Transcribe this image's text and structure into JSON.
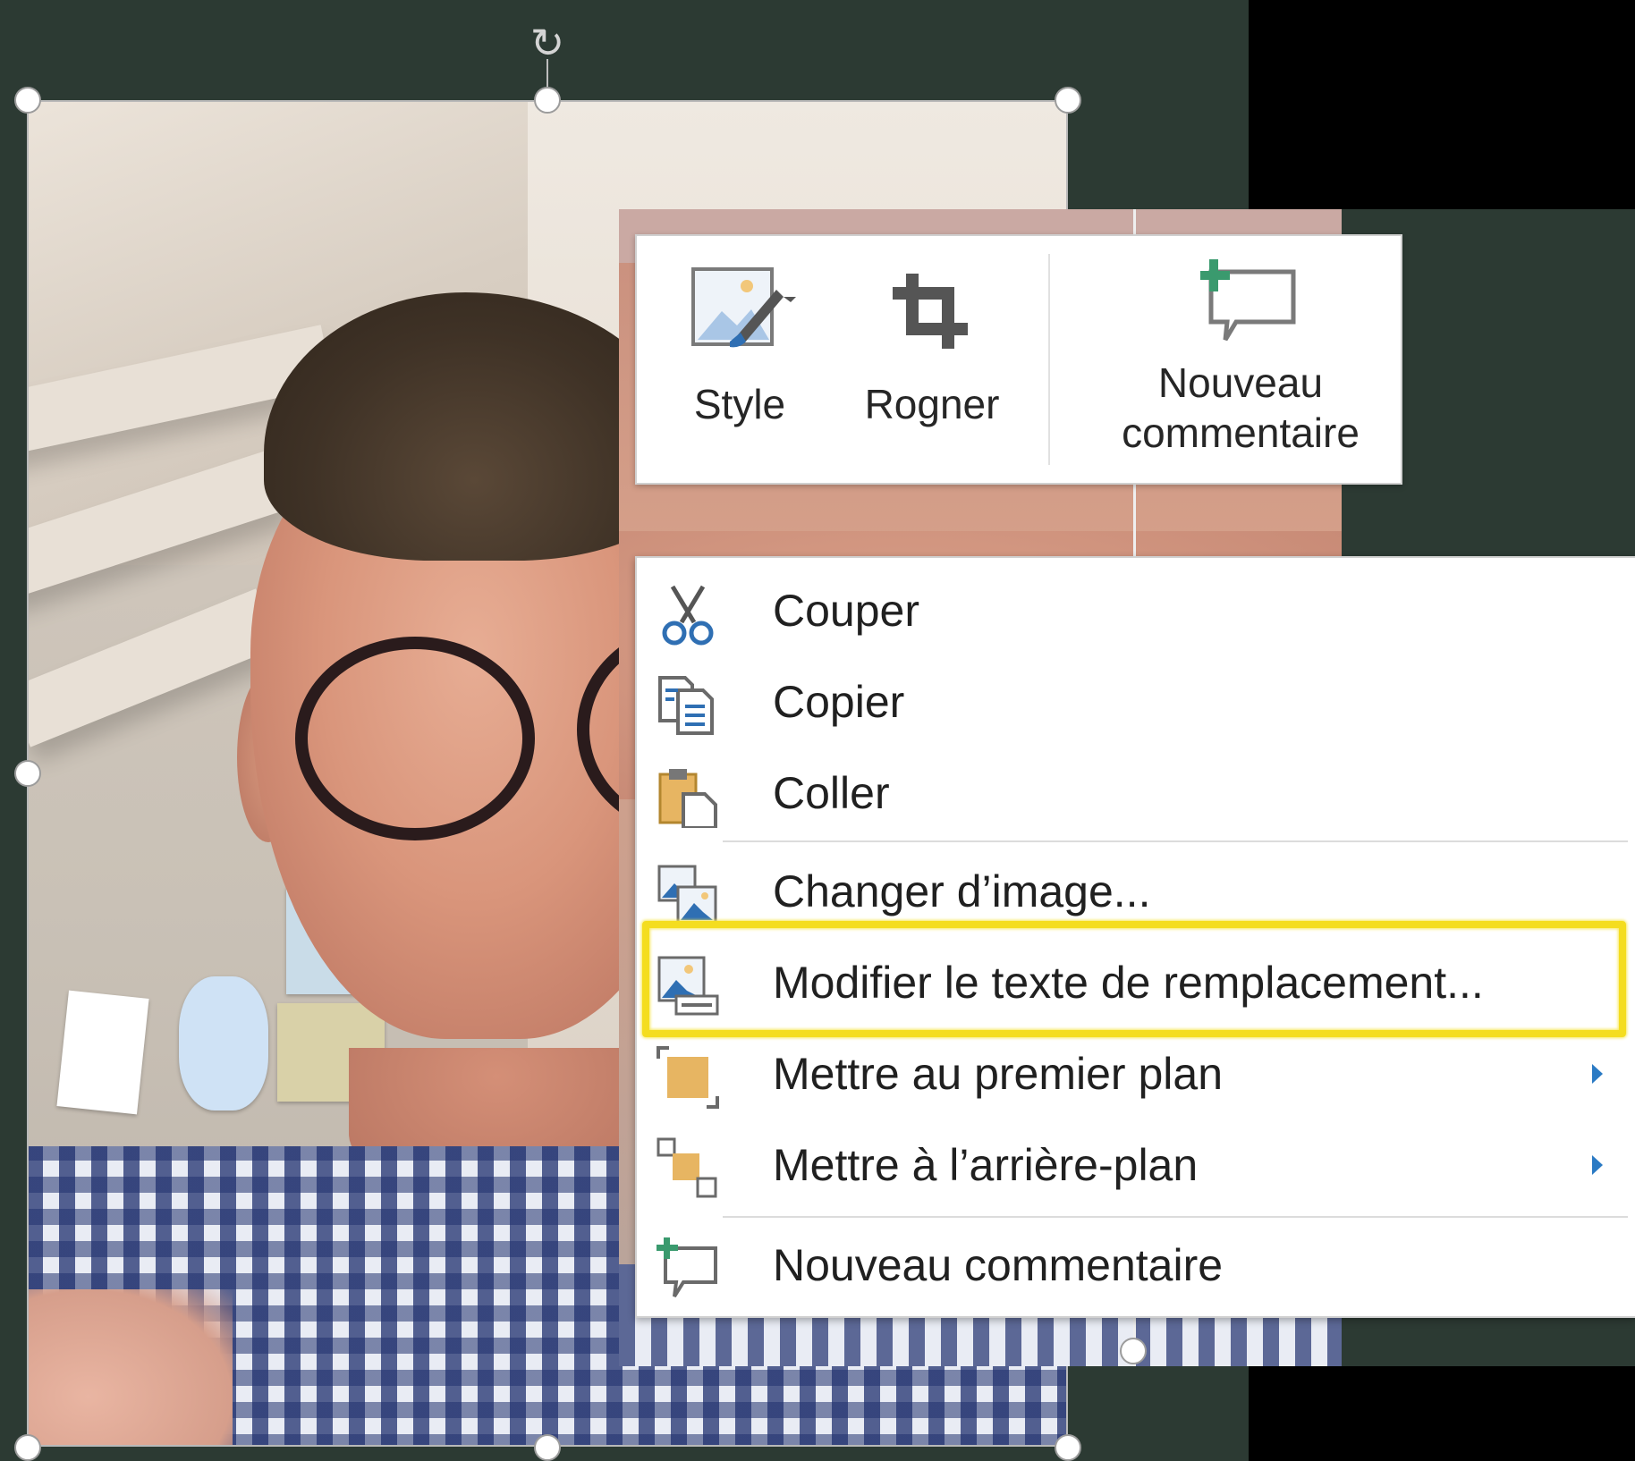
{
  "mini_toolbar": {
    "style_label": "Style",
    "crop_label": "Rogner",
    "new_comment_line1": "Nouveau",
    "new_comment_line2": "commentaire"
  },
  "context_menu": {
    "items": [
      {
        "label": "Couper",
        "icon": "scissors-icon"
      },
      {
        "label": "Copier",
        "icon": "copy-icon"
      },
      {
        "label": "Coller",
        "icon": "paste-icon"
      },
      {
        "label": "Changer d’image...",
        "icon": "change-picture-icon"
      },
      {
        "label": "Modifier le texte de remplacement...",
        "icon": "alt-text-icon",
        "highlighted": true
      },
      {
        "label": "Mettre au premier plan",
        "icon": "bring-to-front-icon",
        "submenu": true
      },
      {
        "label": "Mettre à l’arrière-plan",
        "icon": "send-to-back-icon",
        "submenu": true
      },
      {
        "label": "Nouveau commentaire",
        "icon": "new-comment-icon"
      }
    ]
  },
  "colors": {
    "slide_background": "#2c3a33",
    "highlight": "#f4dd1f",
    "accent_green": "#3a9a6e",
    "submenu_arrow": "#2a7ac4"
  }
}
